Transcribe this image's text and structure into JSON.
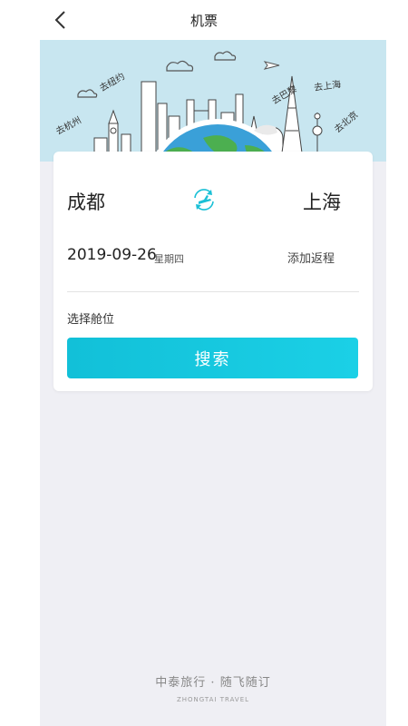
{
  "navbar": {
    "title": "机票"
  },
  "banner": {
    "labels": {
      "newyork": "去纽约",
      "hangzhou": "去杭州",
      "paris": "去巴黎",
      "shanghai": "去上海",
      "beijing": "去北京"
    }
  },
  "search": {
    "from_city": "成都",
    "to_city": "上海",
    "date": "2019-09-26",
    "weekday": "星期四",
    "add_return": "添加返程",
    "cabin": "选择舱位",
    "button_label": "搜索"
  },
  "footer": {
    "slogan": "中泰旅行 · 随飞随订",
    "english": "ZHONGTAI TRAVEL"
  },
  "colors": {
    "accent": "#12c0d8",
    "banner_bg": "#c8e6f0",
    "page_bg": "#efeff4"
  },
  "icons": {
    "back": "chevron-left-icon",
    "swap": "swap-plane-icon"
  }
}
